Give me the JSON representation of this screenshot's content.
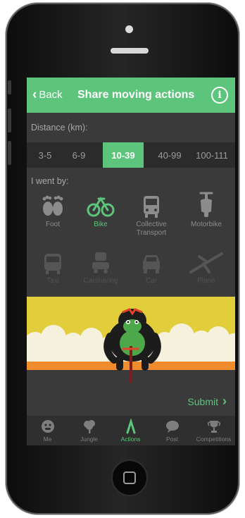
{
  "header": {
    "back_label": "Back",
    "title": "Share moving actions",
    "info_symbol": "i"
  },
  "distance": {
    "label": "Distance (km):",
    "ranges": [
      "3-5",
      "6-9",
      "10-39",
      "40-99",
      "100-111"
    ],
    "selected": "10-39"
  },
  "transport": {
    "label": "I went by:",
    "modes": [
      {
        "label": "Foot",
        "icon": "footprints-icon"
      },
      {
        "label": "Bike",
        "icon": "bike-icon",
        "selected": true
      },
      {
        "label": "Collective Transport",
        "icon": "bus-icon"
      },
      {
        "label": "Motorbike",
        "icon": "scooter-icon"
      },
      {
        "label": "Taxi",
        "icon": "taxi-icon",
        "disabled": true
      },
      {
        "label": "Carsharing",
        "icon": "carsharing-icon",
        "disabled": true
      },
      {
        "label": "Car",
        "icon": "car-icon",
        "disabled": true
      },
      {
        "label": "Plane",
        "icon": "plane-icon",
        "disabled": true
      }
    ]
  },
  "banner": {
    "illustration": "gorilla-riding-bike"
  },
  "submit_label": "Submit",
  "tabs": [
    {
      "label": "Me",
      "icon": "gorilla-face-icon"
    },
    {
      "label": "Jungle",
      "icon": "tree-icon"
    },
    {
      "label": "Actions",
      "icon": "lambda-icon",
      "selected": true
    },
    {
      "label": "Post",
      "icon": "speech-bubble-icon"
    },
    {
      "label": "Competitions",
      "icon": "trophy-icon"
    }
  ],
  "colors": {
    "accent": "#5dc47b",
    "header": "#5dc47b",
    "background": "#3a3a3a",
    "banner_yellow": "#e2ce3b",
    "banner_orange": "#f08c2e"
  }
}
